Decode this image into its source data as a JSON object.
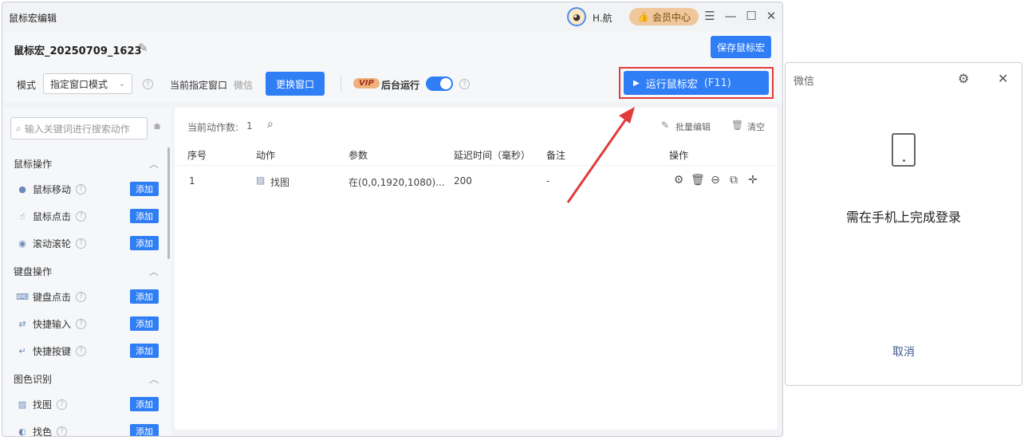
{
  "main_window": {
    "title": "鼠标宏编辑",
    "user_name": "H.航",
    "member_center": "会员中心",
    "macro_name": "鼠标宏_20250709_1623",
    "save_label": "保存鼠标宏",
    "toolbar": {
      "mode_label": "模式",
      "mode_value": "指定窗口模式",
      "target_window_label": "当前指定窗口",
      "target_window_value": "微信",
      "switch_window": "更换窗口",
      "vip_badge": "VIP",
      "background_run_label": "后台运行",
      "background_run_on": true,
      "run_label": "运行鼠标宏",
      "run_hotkey": "(F11)"
    },
    "sidebar": {
      "search_placeholder": "输入关键词进行搜索动作",
      "add_label": "添加",
      "sections": [
        {
          "title": "鼠标操作",
          "items": [
            {
              "label": "鼠标移动",
              "icon": "mouse-icon"
            },
            {
              "label": "鼠标点击",
              "icon": "pointer-icon"
            },
            {
              "label": "滚动滚轮",
              "icon": "scroll-icon"
            }
          ]
        },
        {
          "title": "键盘操作",
          "items": [
            {
              "label": "键盘点击",
              "icon": "keyboard-icon"
            },
            {
              "label": "快捷输入",
              "icon": "input-icon"
            },
            {
              "label": "快捷按键",
              "icon": "hotkey-icon"
            }
          ]
        },
        {
          "title": "图色识别",
          "items": [
            {
              "label": "找图",
              "icon": "image-icon"
            },
            {
              "label": "找色",
              "icon": "color-icon"
            }
          ]
        }
      ]
    },
    "table": {
      "action_count_label": "当前动作数:",
      "action_count": "1",
      "batch_edit": "批量编辑",
      "clear": "清空",
      "headers": [
        "序号",
        "动作",
        "参数",
        "延迟时间（毫秒）",
        "备注",
        "操作"
      ],
      "rows": [
        {
          "index": "1",
          "action": "找图",
          "params": "在(0,0,1920,1080)...",
          "delay": "200",
          "note": "-"
        }
      ],
      "row_ops": [
        "settings-icon",
        "delete-icon",
        "more-icon",
        "copy-icon",
        "move-icon"
      ]
    }
  },
  "wechat_window": {
    "title": "微信",
    "message": "需在手机上完成登录",
    "cancel": "取消"
  },
  "colors": {
    "accent": "#2f7ef5",
    "highlight_outline": "#e23b3b",
    "member_badge": "#efc79a"
  }
}
